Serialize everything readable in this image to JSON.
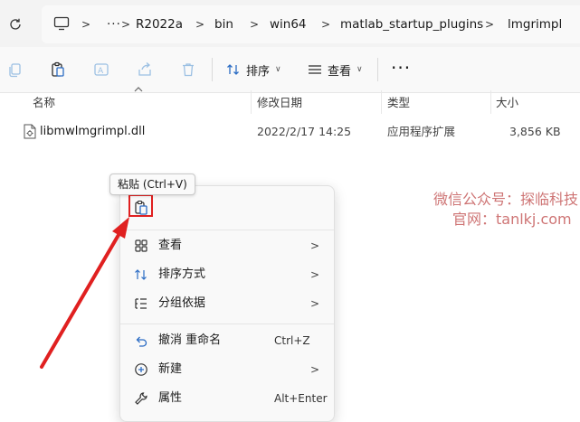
{
  "breadcrumb": {
    "items": [
      "R2022a",
      "bin",
      "win64",
      "matlab_startup_plugins",
      "lmgrimpl"
    ],
    "more": "···"
  },
  "toolbar": {
    "sort_label": "排序",
    "view_label": "查看",
    "more": "···"
  },
  "columns": {
    "name": "名称",
    "modified": "修改日期",
    "type": "类型",
    "size": "大小"
  },
  "file": {
    "name": "libmwlmgrimpl.dll",
    "modified": "2022/2/17 14:25",
    "type": "应用程序扩展",
    "size": "3,856 KB"
  },
  "tooltip": {
    "text": "粘贴 (Ctrl+V)"
  },
  "menu": {
    "items": [
      {
        "label": "查看",
        "shortcut": "",
        "icon": "grid-icon"
      },
      {
        "label": "排序方式",
        "shortcut": "",
        "icon": "sort-icon"
      },
      {
        "label": "分组依据",
        "shortcut": "",
        "icon": "group-icon"
      },
      {
        "label": "撤消 重命名",
        "shortcut": "Ctrl+Z",
        "icon": "undo-icon"
      },
      {
        "label": "新建",
        "shortcut": "",
        "icon": "new-icon"
      },
      {
        "label": "属性",
        "shortcut": "Alt+Enter",
        "icon": "wrench-icon"
      }
    ]
  },
  "watermark": {
    "line1": "微信公众号：探临科技",
    "line2": "官网：tanlkj.com"
  },
  "colors": {
    "accent": "#0067c0",
    "highlight": "#e02020",
    "watermark": "#be4646"
  }
}
